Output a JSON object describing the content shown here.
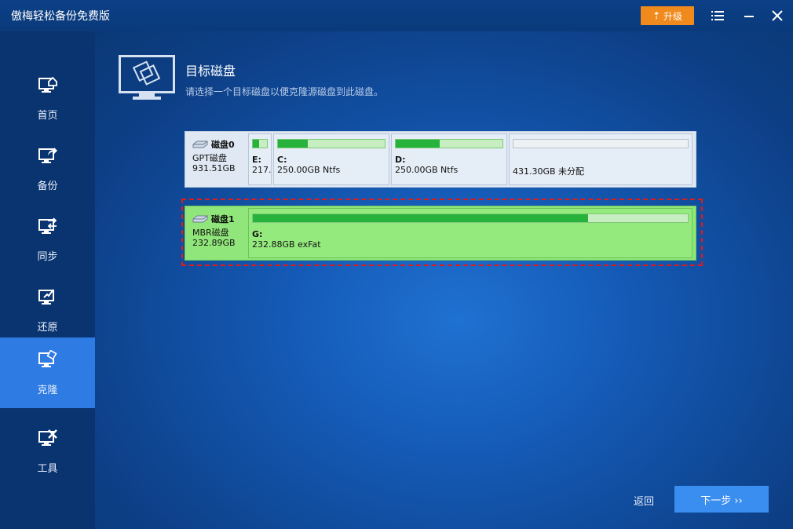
{
  "app": {
    "title": "傲梅轻松备份免费版",
    "upgrade_label": "升级"
  },
  "sidebar": {
    "items": [
      {
        "label": "首页",
        "icon": "home-monitor-icon"
      },
      {
        "label": "备份",
        "icon": "backup-monitor-icon"
      },
      {
        "label": "同步",
        "icon": "sync-monitor-icon"
      },
      {
        "label": "还原",
        "icon": "restore-monitor-icon"
      },
      {
        "label": "克隆",
        "icon": "clone-monitor-icon",
        "active": true
      },
      {
        "label": "工具",
        "icon": "tools-monitor-icon"
      }
    ]
  },
  "header": {
    "title": "目标磁盘",
    "subtitle": "请选择一个目标磁盘以便克隆源磁盘到此磁盘。"
  },
  "disks": [
    {
      "name": "磁盘0",
      "type": "GPT磁盘",
      "size": "931.51GB",
      "partitions": [
        {
          "letter": "E:",
          "size": "217.",
          "used": 0.45
        },
        {
          "letter": "C:",
          "size": "250.00GB Ntfs",
          "used": 0.28
        },
        {
          "letter": "D:",
          "size": "250.00GB Ntfs",
          "used": 0.41
        },
        {
          "letter": "",
          "size": "431.30GB 未分配",
          "used": 0
        }
      ]
    },
    {
      "name": "磁盘1",
      "type": "MBR磁盘",
      "size": "232.89GB",
      "selected": true,
      "partitions": [
        {
          "letter": "G:",
          "size": "232.88GB exFat",
          "used": 0.77
        }
      ]
    }
  ],
  "footer": {
    "back_label": "返回",
    "next_label": "下一步 ››"
  },
  "colors": {
    "accent": "#2e7be4",
    "upgrade": "#f08a1c",
    "selected_disk": "#90e67a",
    "used_fill": "#27b33b",
    "selection_border": "#e11a1a"
  }
}
